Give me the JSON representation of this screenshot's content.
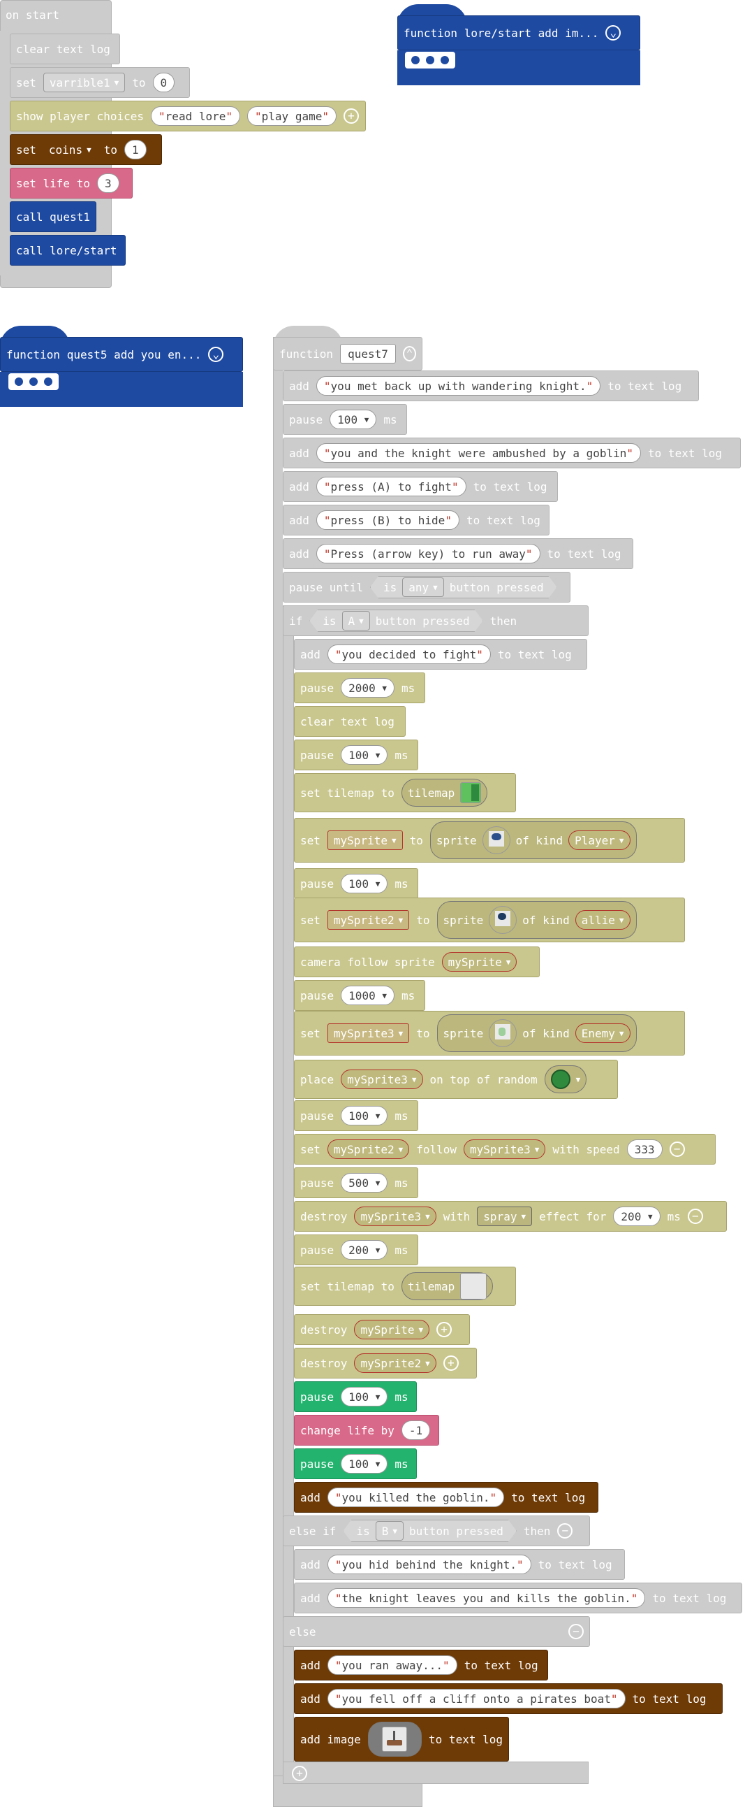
{
  "on_start": {
    "hat": "on start",
    "clear": "clear text log",
    "set_label": "set",
    "set_var": "varrible1",
    "set_to": "to",
    "set_val": "0",
    "choices_label": "show player choices",
    "choice1": "read lore",
    "choice2": "play game",
    "coins_set": "set",
    "coins_var": "coins",
    "coins_to": "to",
    "coins_val": "1",
    "life_label": "set life to",
    "life_val": "3",
    "call1": "call quest1",
    "call2": "call lore/start"
  },
  "func_lore": {
    "title": "function lore/start  add im..."
  },
  "func_quest5": {
    "title": "function quest5  add you en..."
  },
  "quest7": {
    "function_label": "function",
    "name": "quest7",
    "add": "add",
    "to_text_log": "to text log",
    "pause": "pause",
    "ms": "ms",
    "msg1": "you met back up with wandering knight.",
    "pause1": "100",
    "msg2": "you and the knight were ambushed by a goblin",
    "msg3": "press (A) to fight",
    "msg4": "press (B) to hide",
    "msg5": "Press (arrow key) to run away",
    "pause_until": "pause until",
    "is": "is",
    "any": "any",
    "button_pressed": "button pressed",
    "if": "if",
    "btn_a": "A",
    "then": "then",
    "a_msg1": "you decided to fight",
    "a_pause1": "2000",
    "clear": "clear text log",
    "a_pause2": "100",
    "set_tilemap": "set tilemap to",
    "tilemap": "tilemap",
    "set": "set",
    "to": "to",
    "sprite": "sprite",
    "of_kind": "of kind",
    "v_mySprite": "mySprite",
    "k_player": "Player",
    "a_pause3": "100",
    "v_mySprite2": "mySprite2",
    "k_allie": "allie",
    "camera_follow": "camera follow sprite",
    "a_pause4": "1000",
    "v_mySprite3": "mySprite3",
    "k_enemy": "Enemy",
    "place": "place",
    "on_top_of_random": "on top of random",
    "a_pause5": "100",
    "follow": "follow",
    "with_speed": "with speed",
    "speed": "333",
    "a_pause6": "500",
    "destroy": "destroy",
    "with": "with",
    "spray": "spray",
    "effect_for": "effect for",
    "effect_ms": "200",
    "a_pause7": "200",
    "g_pause1": "100",
    "change_life": "change life by",
    "change_val": "-1",
    "g_pause2": "100",
    "killed": "you killed the goblin.",
    "else_if": "else if",
    "btn_b": "B",
    "b_msg1": "you hid behind the knight.",
    "b_msg2": "the knight leaves you and kills the goblin.",
    "else": "else",
    "e_msg1": "you ran away...",
    "e_msg2": "you fell off a cliff onto a pirates boat",
    "add_image": "add image",
    "image_to_log": "to text log"
  },
  "colors": {
    "grey_block": "#cccccc",
    "scene_olive": "#c9c78e",
    "info_brown": "#6e3a06",
    "life_pink": "#d8698a",
    "function_blue": "#1e4aa1",
    "loops_green": "#23b36e"
  }
}
